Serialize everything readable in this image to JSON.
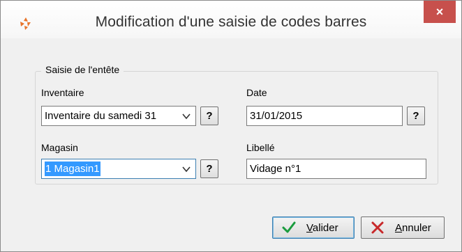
{
  "window": {
    "title": "Modification d'une saisie de codes barres",
    "close_glyph": "×",
    "icon": "app-logo-icon"
  },
  "group": {
    "label": "Saisie de l'entête"
  },
  "inventaire": {
    "label": "Inventaire",
    "value": "Inventaire du samedi 31",
    "help_label": "?"
  },
  "date": {
    "label": "Date",
    "value": "31/01/2015",
    "help_label": "?"
  },
  "magasin": {
    "label": "Magasin",
    "value": "1 Magasin1",
    "help_label": "?"
  },
  "libelle": {
    "label": "Libellé",
    "value": "Vidage n°1"
  },
  "buttons": {
    "valider_first": "V",
    "valider_rest": "alider",
    "annuler_first": "A",
    "annuler_rest": "nnuler"
  },
  "colors": {
    "close": "#c7504c",
    "selection": "#3399ff",
    "check": "#1a9c3e",
    "cross": "#c8282a"
  }
}
